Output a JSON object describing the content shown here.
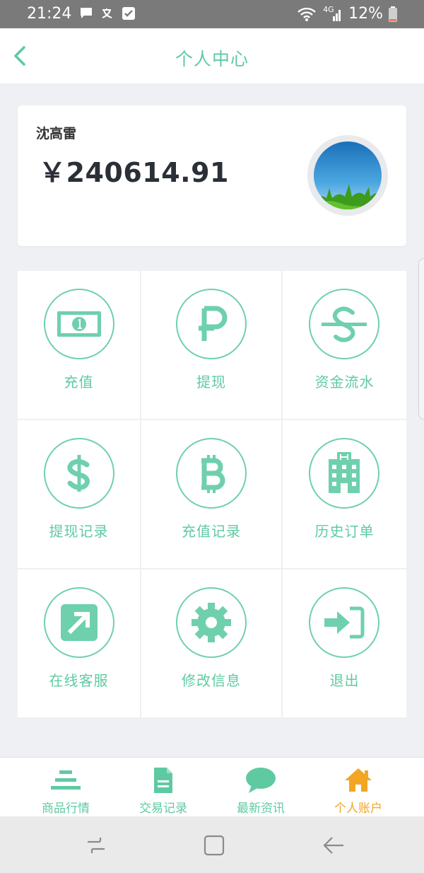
{
  "status_bar": {
    "time": "21:24",
    "network": "4G",
    "battery": "12%"
  },
  "header": {
    "title": "个人中心"
  },
  "account": {
    "name": "沈高雷",
    "balance": "￥240614.91"
  },
  "grid": [
    {
      "label": "充值",
      "icon": "banknote-icon"
    },
    {
      "label": "提现",
      "icon": "ruble-icon"
    },
    {
      "label": "资金流水",
      "icon": "shekel-s-icon"
    },
    {
      "label": "提现记录",
      "icon": "dollar-icon"
    },
    {
      "label": "充值记录",
      "icon": "bitcoin-icon"
    },
    {
      "label": "历史订单",
      "icon": "hospital-building-icon"
    },
    {
      "label": "在线客服",
      "icon": "external-link-icon"
    },
    {
      "label": "修改信息",
      "icon": "gear-icon"
    },
    {
      "label": "退出",
      "icon": "sign-in-icon"
    }
  ],
  "tabs": [
    {
      "label": "商品行情",
      "icon": "list-lines-icon"
    },
    {
      "label": "交易记录",
      "icon": "document-icon"
    },
    {
      "label": "最新资讯",
      "icon": "chat-bubble-icon"
    },
    {
      "label": "个人账户",
      "icon": "home-icon",
      "active": true
    }
  ],
  "colors": {
    "accent": "#5fcaa2",
    "active_tab": "#f2a623",
    "status_bar": "#7a7a7a",
    "background": "#eef0f3"
  }
}
